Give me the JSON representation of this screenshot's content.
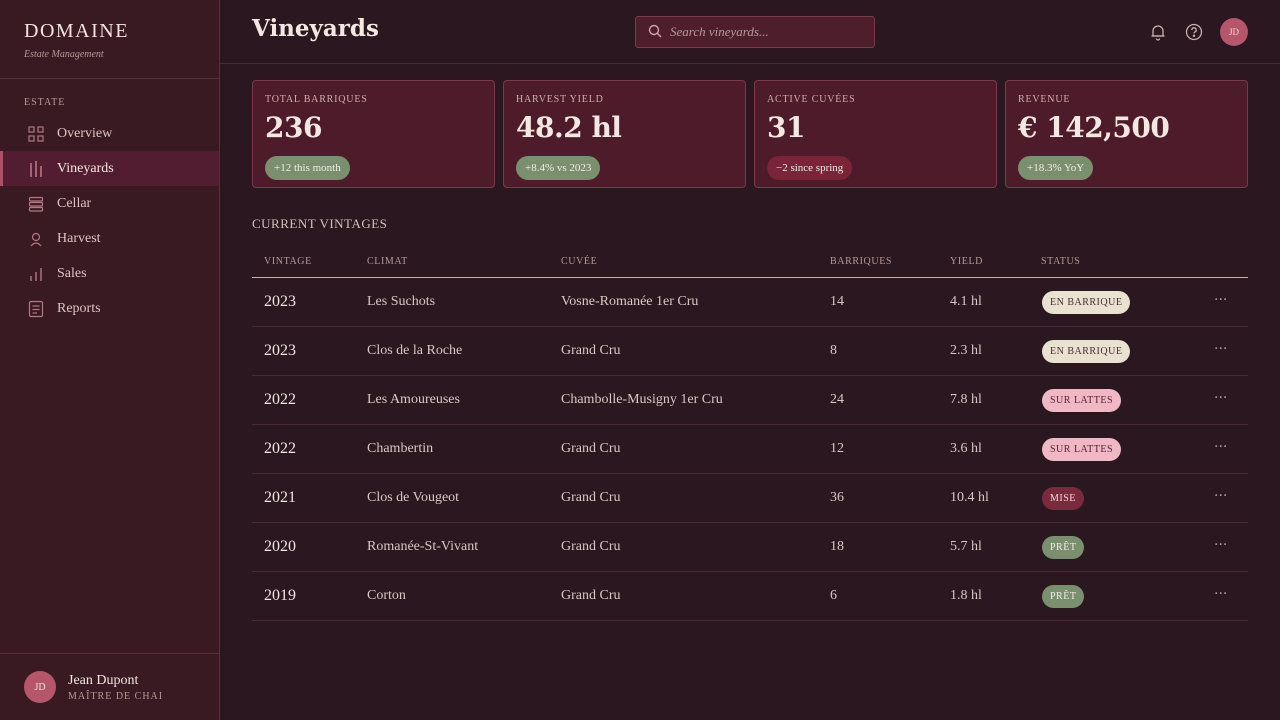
{
  "brand": {
    "title": "DOMAINE",
    "subtitle": "Estate Management"
  },
  "sidebar": {
    "section": "ESTATE",
    "items": [
      {
        "label": "Overview",
        "icon": "grid-icon"
      },
      {
        "label": "Vineyards",
        "icon": "vine-bars-icon",
        "active": true
      },
      {
        "label": "Cellar",
        "icon": "barrel-stack-icon"
      },
      {
        "label": "Harvest",
        "icon": "grape-icon"
      },
      {
        "label": "Sales",
        "icon": "bar-chart-icon"
      },
      {
        "label": "Reports",
        "icon": "document-icon"
      }
    ]
  },
  "user": {
    "initials": "JD",
    "name": "Jean Dupont",
    "role": "MAÎTRE DE CHAI"
  },
  "header": {
    "title": "Vineyards",
    "search_placeholder": "Search vineyards...",
    "avatar_initials": "JD"
  },
  "cards": [
    {
      "label": "TOTAL BARRIQUES",
      "value": "236",
      "delta": "+12 this month",
      "tone": "green"
    },
    {
      "label": "HARVEST YIELD",
      "value": "48.2 hl",
      "delta": "+8.4% vs 2023",
      "tone": "green"
    },
    {
      "label": "ACTIVE CUVÉES",
      "value": "31",
      "delta": "−2 since spring",
      "tone": "red"
    },
    {
      "label": "REVENUE",
      "value": "€ 142,500",
      "delta": "+18.3% YoY",
      "tone": "green"
    }
  ],
  "table": {
    "title": "CURRENT VINTAGES",
    "headers": {
      "vintage": "VINTAGE",
      "climat": "CLIMAT",
      "cuvee": "CUVÉE",
      "barriques": "BARRIQUES",
      "yield": "YIELD",
      "status": "STATUS"
    },
    "rows": [
      {
        "vintage": "2023",
        "climat": "Les Suchots",
        "cuvee": "Vosne-Romanée 1er Cru",
        "barriques": "14",
        "yield": "4.1 hl",
        "status": "EN BARRIQUE",
        "status_kind": "barrique"
      },
      {
        "vintage": "2023",
        "climat": "Clos de la Roche",
        "cuvee": "Grand Cru",
        "barriques": "8",
        "yield": "2.3 hl",
        "status": "EN BARRIQUE",
        "status_kind": "barrique"
      },
      {
        "vintage": "2022",
        "climat": "Les Amoureuses",
        "cuvee": "Chambolle-Musigny 1er Cru",
        "barriques": "24",
        "yield": "7.8 hl",
        "status": "SUR LATTES",
        "status_kind": "lattes"
      },
      {
        "vintage": "2022",
        "climat": "Chambertin",
        "cuvee": "Grand Cru",
        "barriques": "12",
        "yield": "3.6 hl",
        "status": "SUR LATTES",
        "status_kind": "lattes"
      },
      {
        "vintage": "2021",
        "climat": "Clos de Vougeot",
        "cuvee": "Grand Cru",
        "barriques": "36",
        "yield": "10.4 hl",
        "status": "MISE",
        "status_kind": "mise"
      },
      {
        "vintage": "2020",
        "climat": "Romanée-St-Vivant",
        "cuvee": "Grand Cru",
        "barriques": "18",
        "yield": "5.7 hl",
        "status": "PRÊT",
        "status_kind": "pret"
      },
      {
        "vintage": "2019",
        "climat": "Corton",
        "cuvee": "Grand Cru",
        "barriques": "6",
        "yield": "1.8 hl",
        "status": "PRÊT",
        "status_kind": "pret"
      }
    ],
    "row_action": "···"
  }
}
